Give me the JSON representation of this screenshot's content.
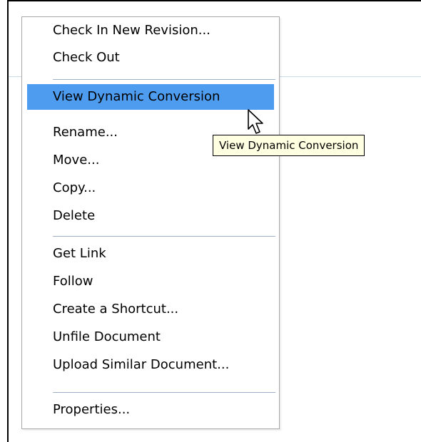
{
  "menu": {
    "items": [
      {
        "label": "Check In New Revision..."
      },
      {
        "label": "Check Out"
      },
      {
        "label": "View Dynamic Conversion",
        "highlighted": true
      },
      {
        "label": "Rename..."
      },
      {
        "label": "Move..."
      },
      {
        "label": "Copy..."
      },
      {
        "label": "Delete"
      },
      {
        "label": "Get Link"
      },
      {
        "label": "Follow"
      },
      {
        "label": "Create a Shortcut..."
      },
      {
        "label": "Unfile Document"
      },
      {
        "label": "Upload Similar Document..."
      },
      {
        "label": "Properties..."
      }
    ]
  },
  "tooltip": {
    "text": "View Dynamic Conversion"
  },
  "colors": {
    "highlight": "#4d9cf0",
    "tooltip_bg": "#ffffe1",
    "separator": "#9fb1c6"
  },
  "icons": {
    "cursor": "arrow-pointer-icon"
  }
}
